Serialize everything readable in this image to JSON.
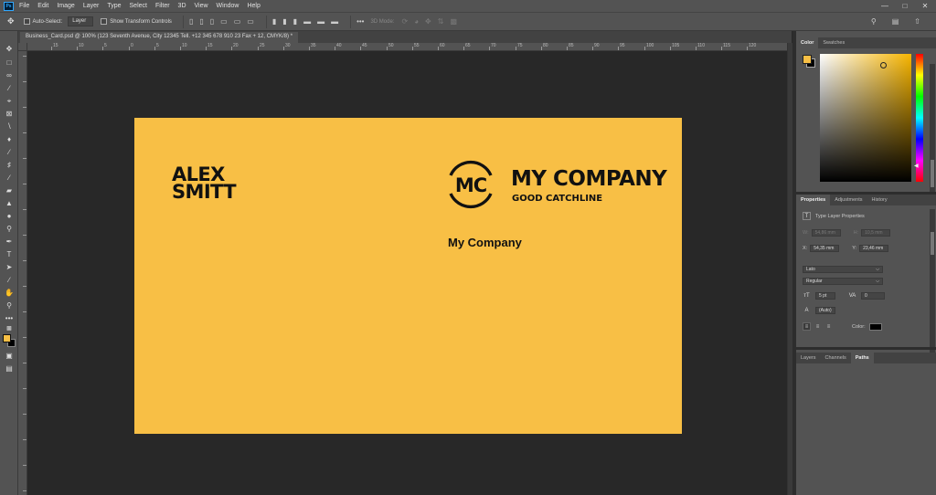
{
  "app": {
    "logo": "Ps"
  },
  "menubar": {
    "items": [
      "File",
      "Edit",
      "Image",
      "Layer",
      "Type",
      "Select",
      "Filter",
      "3D",
      "View",
      "Window",
      "Help"
    ],
    "window_controls": [
      "minimize-icon",
      "maximize-icon",
      "close-icon"
    ]
  },
  "options_bar": {
    "auto_select_label": "Auto-Select:",
    "auto_select_value": "Layer",
    "show_transform_label": "Show Transform Controls",
    "mode_3d_label": "3D Mode:"
  },
  "document": {
    "tab_title": "Business_Card.psd @ 100% (123 Seventh Avenue, City 12345 Tell. +12 345 678 910 23 Fax + 12, CMYK/8) *"
  },
  "ruler": {
    "labels": [
      "15",
      "10",
      "5",
      "0",
      "5",
      "10",
      "15",
      "20",
      "25",
      "30",
      "35",
      "40",
      "45",
      "50",
      "55",
      "60",
      "65",
      "70",
      "75",
      "80",
      "85",
      "90",
      "95",
      "100",
      "105",
      "110",
      "115",
      "120"
    ]
  },
  "card": {
    "name_line1": "ALEX",
    "name_line2": "SMITT",
    "logo_text": "MC",
    "company_title": "MY COMPANY",
    "catchline": "GOOD CATCHLINE",
    "company_small": "My Company",
    "background": "#f8bf45",
    "text_color": "#111111"
  },
  "color_panel": {
    "tabs": [
      "Color",
      "Swatches"
    ],
    "active_tab": "Color",
    "foreground": "#f7bf45",
    "background": "#000000"
  },
  "properties_panel": {
    "tabs": [
      "Properties",
      "Adjustments",
      "History"
    ],
    "header": "Type Layer Properties",
    "w_label": "W:",
    "w_value": "54,86 mm",
    "h_label": "H:",
    "h_value": "10,5 mm",
    "x_label": "X:",
    "x_value": "54,35 mm",
    "y_label": "Y:",
    "y_value": "23,46 mm",
    "font_family": "Lato",
    "font_style": "Regular",
    "font_size": "5 pt",
    "tracking": "0",
    "leading": "(Auto)",
    "color_label": "Color:",
    "text_color": "#000000"
  },
  "layers_panel": {
    "tabs": [
      "Layers",
      "Channels",
      "Paths"
    ],
    "active_tab": "Paths"
  }
}
